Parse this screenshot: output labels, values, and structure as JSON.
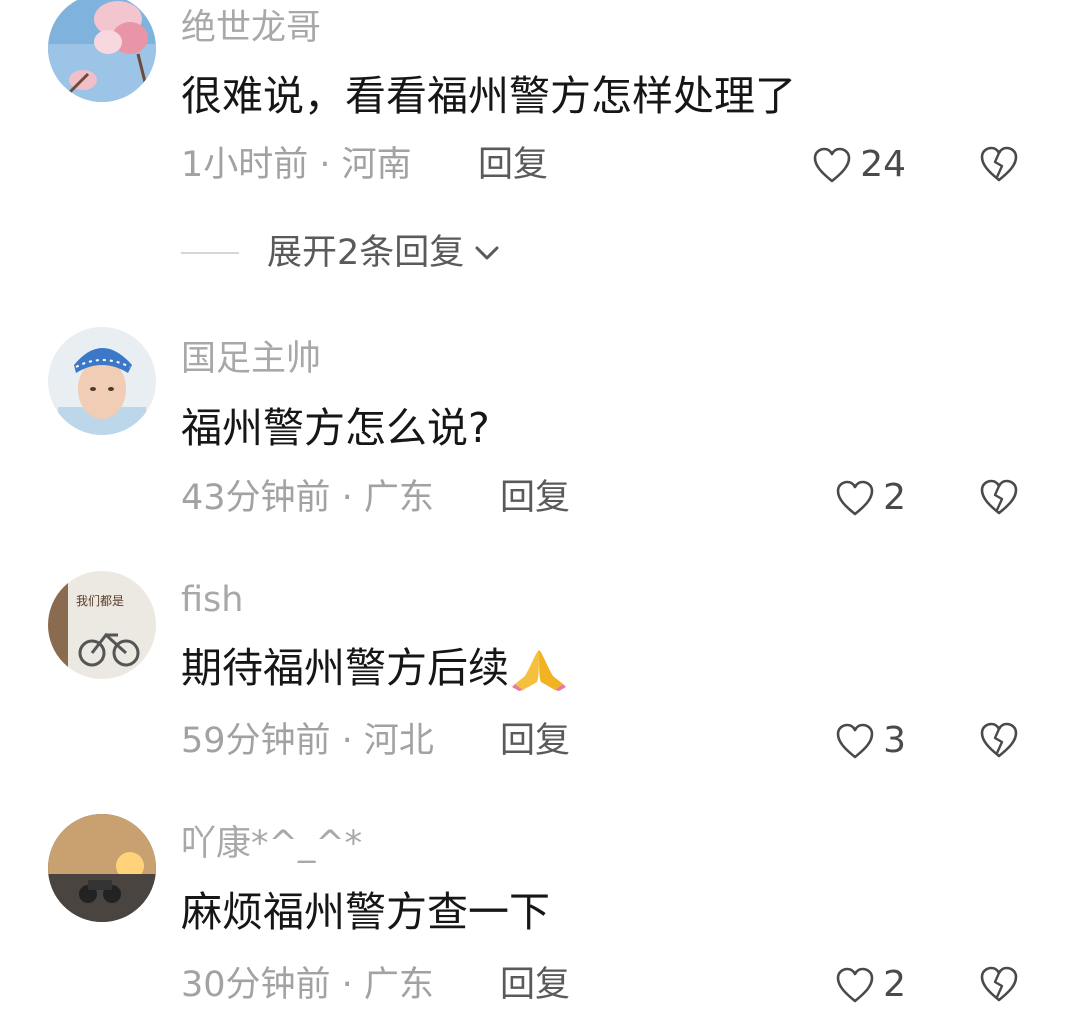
{
  "comments": [
    {
      "username": "绝世龙哥",
      "text": "很难说，看看福州警方怎样处理了",
      "meta": "1小时前 · 河南",
      "reply_label": "回复",
      "likes": "24",
      "avatar_icon": "magnolia-flower-avatar"
    },
    {
      "username": "国足主帅",
      "text": "福州警方怎么说?",
      "meta": "43分钟前 · 广东",
      "reply_label": "回复",
      "likes": "2",
      "avatar_icon": "anime-boy-headband-avatar"
    },
    {
      "username": "fish",
      "text": "期待福州警方后续",
      "emoji": "folded-hands-emoji",
      "meta": "59分钟前 · 河北",
      "reply_label": "回复",
      "likes": "3",
      "avatar_icon": "bicycle-wall-avatar"
    },
    {
      "username": "吖康*^_^*",
      "text": "麻烦福州警方查一下",
      "meta": "30分钟前 · 广东",
      "reply_label": "回复",
      "likes": "2",
      "avatar_icon": "sunset-motorcycle-avatar"
    }
  ],
  "expand_replies": {
    "label": "展开2条回复"
  },
  "colors": {
    "text": "#161616",
    "meta": "#a2a2a2",
    "username": "#a8a8a8",
    "icon": "#4a4a4a"
  }
}
